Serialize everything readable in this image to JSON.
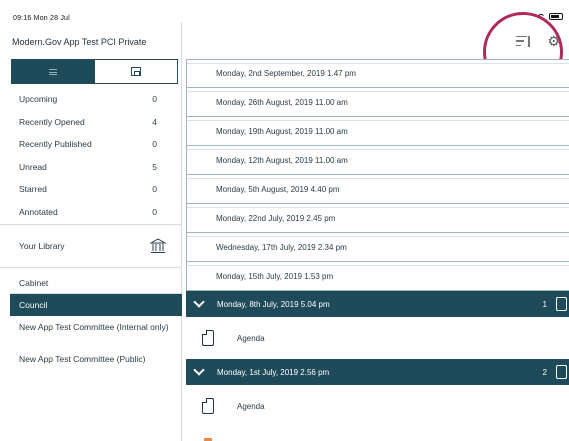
{
  "status_bar": {
    "time_date": "09:16  Mon 28 Jul",
    "battery": ""
  },
  "sidebar": {
    "title": "Modern.Gov App Test PCI Private",
    "filters": [
      {
        "label": "Upcoming",
        "count": "0"
      },
      {
        "label": "Recently Opened",
        "count": "4"
      },
      {
        "label": "Recently Published",
        "count": "0"
      },
      {
        "label": "Unread",
        "count": "5"
      },
      {
        "label": "Starred",
        "count": "0"
      },
      {
        "label": "Annotated",
        "count": "0"
      }
    ],
    "library_label": "Your Library",
    "committees": [
      {
        "label": "Cabinet"
      },
      {
        "label": "Council"
      },
      {
        "label": "New App Test Committee (Internal only)"
      },
      {
        "label": "New App Test Committee (Public)"
      }
    ]
  },
  "meetings": [
    {
      "label": "Monday, 2nd September, 2019 1.47 pm"
    },
    {
      "label": "Monday, 26th August, 2019 11.00 am"
    },
    {
      "label": "Monday, 19th August, 2019 11.00 am"
    },
    {
      "label": "Monday, 12th August, 2019 11.00 am"
    },
    {
      "label": "Monday, 5th August, 2019 4.40 pm"
    },
    {
      "label": "Monday, 22nd July, 2019 2.45 pm"
    },
    {
      "label": "Wednesday, 17th July, 2019 2.34 pm"
    },
    {
      "label": "Monday, 15th July, 2019 1.53 pm"
    }
  ],
  "expanded_meetings": [
    {
      "label": "Monday, 8th July, 2019 5.04 pm",
      "count": "1",
      "agenda": "Agenda"
    },
    {
      "label": "Monday, 1st July, 2019 2.56 pm",
      "count": "2",
      "agenda": "Agenda"
    }
  ],
  "colors": {
    "accent": "#1e4a59",
    "highlight": "#b02a58",
    "divider": "#d6dde2"
  },
  "icons": [
    "list-icon",
    "calendar-icon",
    "library-icon",
    "sort-icon",
    "gear-icon",
    "chevron-down-icon",
    "document-icon"
  ]
}
